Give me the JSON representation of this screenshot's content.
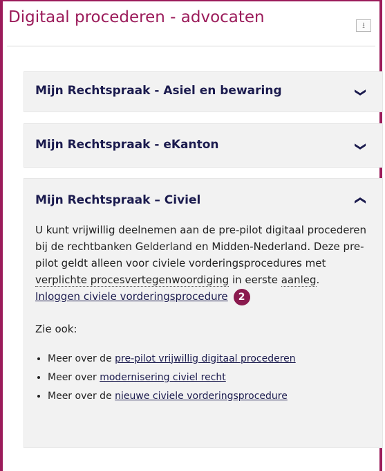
{
  "title": "Digitaal procederen - advocaten",
  "panels": [
    {
      "label": "Mijn Rechtspraak - Asiel en bewaring"
    },
    {
      "label": "Mijn Rechtspraak - eKanton"
    },
    {
      "label": "Mijn Rechtspraak – Civiel",
      "text_a": "U kunt vrijwillig deelnemen aan de pre-pilot digitaal procederen bij de rechtbanken Gelderland en Midden-Nederland. Deze pre-pilot geldt alleen voor civiele vorderingsprocedures met ",
      "term1": "verplichte procesvertegenwoordiging",
      "text_b": " in eerste ",
      "term2": "aanleg",
      "text_c": ".",
      "login_link": "Inloggen civiele vorderingsprocedure",
      "badge": "2",
      "see_also": "Zie ook:",
      "refs": [
        {
          "prefix": "Meer over de ",
          "link": "pre-pilot vrijwillig digitaal procederen"
        },
        {
          "prefix": "Meer over ",
          "link": "modernisering civiel recht"
        },
        {
          "prefix": "Meer over de ",
          "link": "nieuwe civiele vorderingsprocedure"
        }
      ]
    }
  ]
}
